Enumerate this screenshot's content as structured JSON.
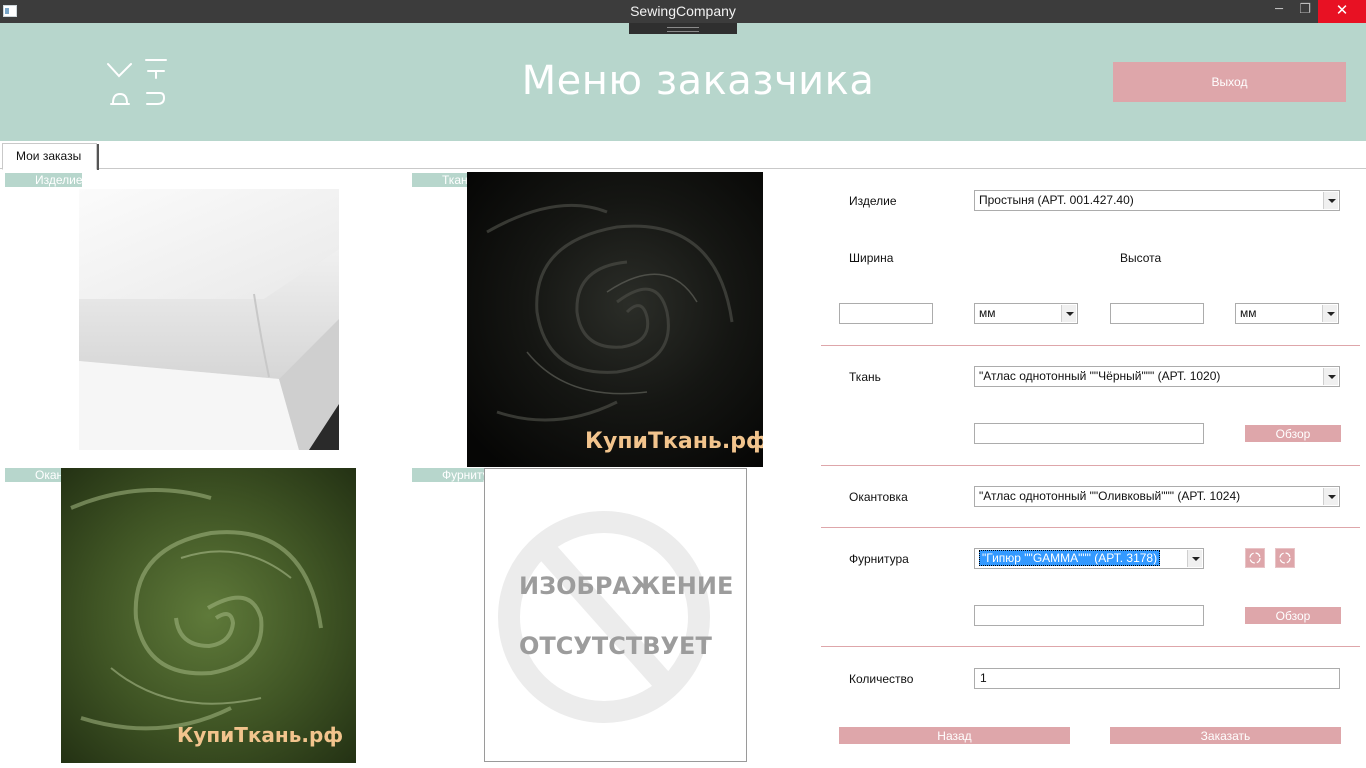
{
  "window": {
    "title": "SewingCompany",
    "minimize_glyph": "─",
    "maximize_glyph": "❐",
    "close_glyph": "✕"
  },
  "header": {
    "page_title": "Меню заказчика",
    "exit_label": "Выход",
    "logo_icon": "needle-thread-logo-icon"
  },
  "tabs": [
    {
      "label": "Мои заказы"
    }
  ],
  "images": {
    "product": {
      "label": "Изделие"
    },
    "fabric": {
      "label": "Ткань",
      "watermark": "КупиТкань.рф"
    },
    "edging": {
      "label": "Окантовка",
      "watermark": "КупиТкань.рф"
    },
    "fittings": {
      "label": "Фурнитура",
      "placeholder_line1": "ИЗОБРАЖЕНИЕ",
      "placeholder_line2": "ОТСУТСТВУЕТ"
    }
  },
  "form": {
    "product_label": "Изделие",
    "product_value": "Простыня (АРТ. 001.427.40)",
    "width_label": "Ширина",
    "height_label": "Высота",
    "width_value": "",
    "height_value": "",
    "width_unit": "мм",
    "height_unit": "мм",
    "fabric_label": "Ткань",
    "fabric_value": "\"Атлас однотонный \"\"Чёрный\"\"\" (АРТ. 1020)",
    "fabric_path": "",
    "browse_label": "Обзор",
    "edging_label": "Окантовка",
    "edging_value": "\"Атлас однотонный \"\"Оливковый\"\"\" (АРТ. 1024)",
    "fittings_label": "Фурнитура",
    "fittings_value": "\"Гипюр \"\"GAMMA\"\"\" (АРТ.  3178)",
    "fittings_path": "",
    "quantity_label": "Количество",
    "quantity_value": "1",
    "back_label": "Назад",
    "order_label": "Заказать"
  },
  "colors": {
    "header_bg": "#b7d6cc",
    "accent_pink": "#dea6aa",
    "titlebar_bg": "#3c3c3c",
    "close_red": "#e81123",
    "selection_blue": "#3399ff"
  }
}
